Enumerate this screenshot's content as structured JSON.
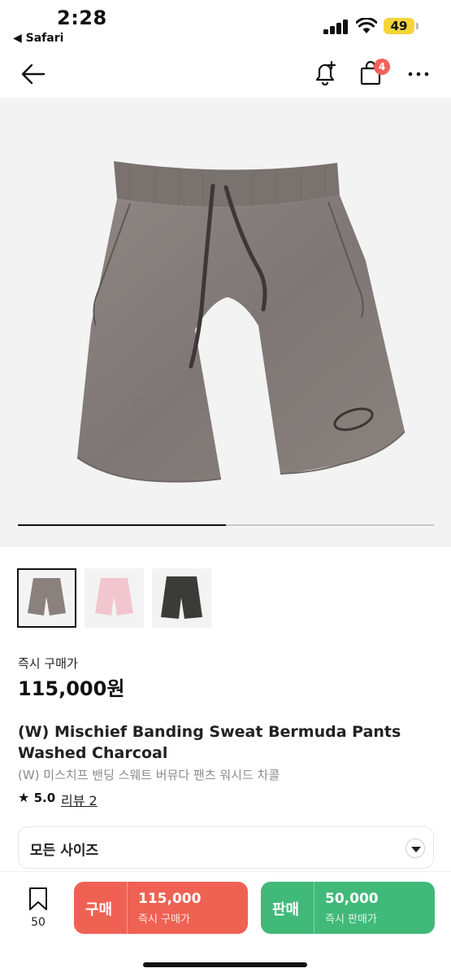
{
  "status_bar": {
    "time": "2:28",
    "back_app": "◀ Safari",
    "battery": "49"
  },
  "nav": {
    "cart_badge": "4",
    "icons": [
      "back-arrow-icon",
      "bell-plus-icon",
      "shopping-bag-icon",
      "more-icon"
    ]
  },
  "gallery": {
    "progress": 0.5,
    "thumbnails": [
      {
        "name": "charcoal",
        "color": "#8a817d",
        "selected": true
      },
      {
        "name": "pink",
        "color": "#f2c6cf",
        "selected": false
      },
      {
        "name": "black",
        "color": "#3b3b38",
        "selected": false
      }
    ]
  },
  "price": {
    "label": "즉시 구매가",
    "value": "115,000원"
  },
  "product": {
    "title_en": "(W) Mischief Banding Sweat Bermuda Pants Washed Charcoal",
    "title_ko": "(W) 미스치프 밴딩 스웨트 버뮤다 팬츠 워시드 차콜",
    "rating": "5.0",
    "review_link": "리뷰 2"
  },
  "size_select": {
    "value": "모든 사이즈"
  },
  "bottom_bar": {
    "bookmark_count": "50",
    "buy": {
      "label": "구매",
      "price": "115,000",
      "sub": "즉시 구매가"
    },
    "sell": {
      "label": "판매",
      "price": "50,000",
      "sub": "즉시 판매가"
    }
  },
  "colors": {
    "buy": "#ef6253",
    "sell": "#41b979",
    "badge": "#f0625a",
    "battery": "#f5d33a"
  }
}
